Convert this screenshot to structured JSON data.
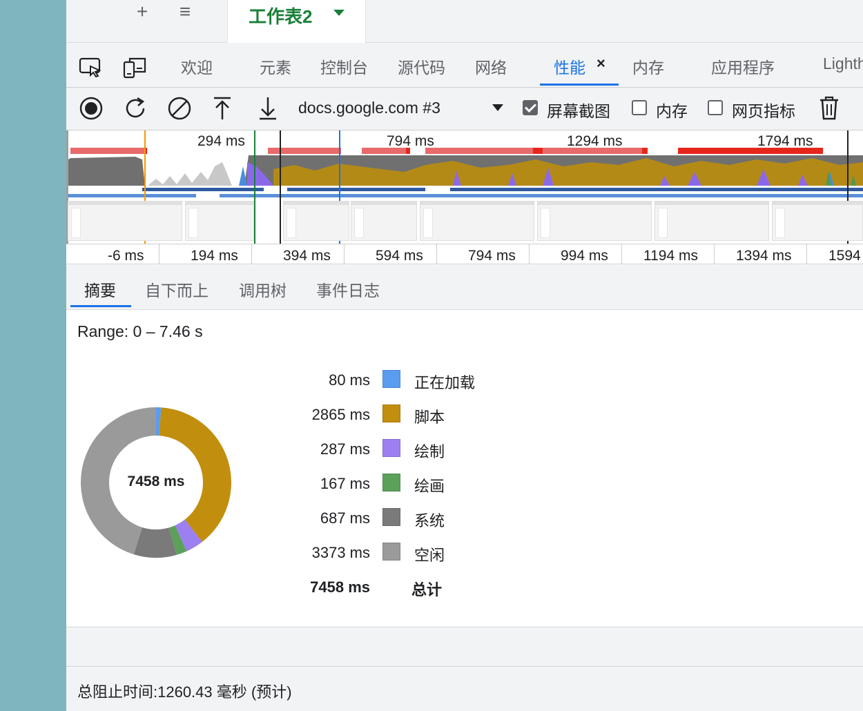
{
  "sheet_tabs": {
    "add_label": "+",
    "menu_label": "≡",
    "active_sheet": "工作表2"
  },
  "devtools": {
    "tabs": [
      "欢迎",
      "元素",
      "控制台",
      "源代码",
      "网络",
      "性能",
      "内存",
      "应用程序",
      "Lighth"
    ],
    "active_tab": "性能",
    "close_glyph": "×"
  },
  "perf_toolbar": {
    "profile": "docs.google.com #3",
    "screenshots_label": "屏幕截图",
    "screenshots_checked": true,
    "memory_label": "内存",
    "memory_checked": false,
    "web_vitals_label": "网页指标",
    "web_vitals_checked": false
  },
  "overview": {
    "top_labels": [
      "294 ms",
      "794 ms",
      "1294 ms",
      "1794 ms"
    ],
    "ruler_labels": [
      "-6 ms",
      "194 ms",
      "394 ms",
      "594 ms",
      "794 ms",
      "994 ms",
      "1194 ms",
      "1394 ms",
      "1594"
    ]
  },
  "bottom_tabs": {
    "tabs": [
      "摘要",
      "自下而上",
      "调用树",
      "事件日志"
    ],
    "active": "摘要"
  },
  "summary": {
    "range": "Range: 0 – 7.46 s",
    "total_center": "7458 ms",
    "legend": [
      {
        "value": "80 ms",
        "name": "正在加载",
        "color": "#5a9cf0",
        "ms": 80
      },
      {
        "value": "2865 ms",
        "name": "脚本",
        "color": "#c28e0e",
        "ms": 2865
      },
      {
        "value": "287 ms",
        "name": "绘制",
        "color": "#9c7ff0",
        "ms": 287
      },
      {
        "value": "167 ms",
        "name": "绘画",
        "color": "#5ca15a",
        "ms": 167
      },
      {
        "value": "687 ms",
        "name": "系统",
        "color": "#7a7a7a",
        "ms": 687
      },
      {
        "value": "3373 ms",
        "name": "空闲",
        "color": "#9a9a9a",
        "ms": 3373
      }
    ],
    "total_value": "7458 ms",
    "total_label": "总计"
  },
  "status": {
    "text": "总阻止时间:1260.43 毫秒 (预计)"
  }
}
